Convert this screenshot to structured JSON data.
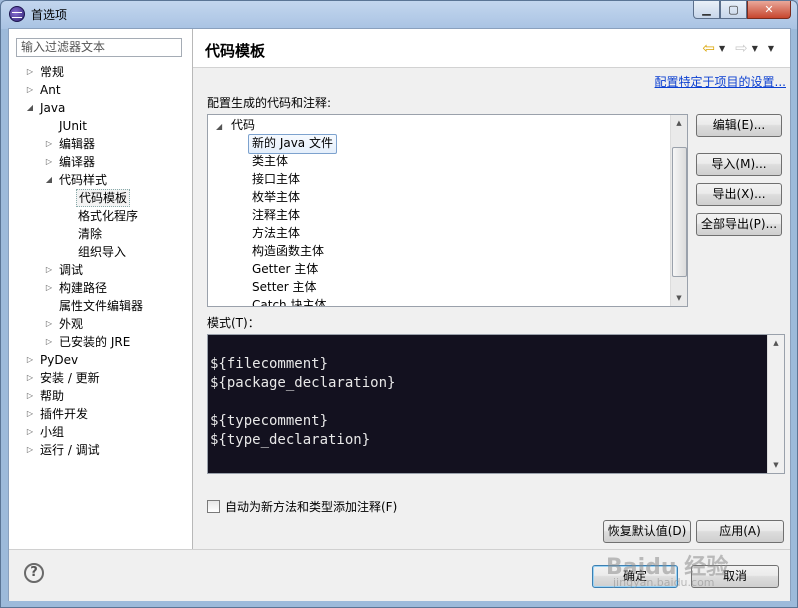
{
  "window": {
    "title": "首选项"
  },
  "sidebar": {
    "filter_placeholder": "输入过滤器文本",
    "tree": [
      {
        "label": "常规",
        "expander": "collapsed"
      },
      {
        "label": "Ant",
        "expander": "collapsed"
      },
      {
        "label": "Java",
        "expander": "expanded"
      },
      {
        "label": "JUnit",
        "expander": "none"
      },
      {
        "label": "编辑器",
        "expander": "collapsed"
      },
      {
        "label": "编译器",
        "expander": "collapsed"
      },
      {
        "label": "代码样式",
        "expander": "expanded"
      },
      {
        "label": "代码模板",
        "expander": "none",
        "selected": true
      },
      {
        "label": "格式化程序",
        "expander": "none"
      },
      {
        "label": "清除",
        "expander": "none"
      },
      {
        "label": "组织导入",
        "expander": "none"
      },
      {
        "label": "调试",
        "expander": "collapsed"
      },
      {
        "label": "构建路径",
        "expander": "collapsed"
      },
      {
        "label": "属性文件编辑器",
        "expander": "none"
      },
      {
        "label": "外观",
        "expander": "collapsed"
      },
      {
        "label": "已安装的 JRE",
        "expander": "collapsed"
      },
      {
        "label": "PyDev",
        "expander": "collapsed"
      },
      {
        "label": "安装 / 更新",
        "expander": "collapsed"
      },
      {
        "label": "帮助",
        "expander": "collapsed"
      },
      {
        "label": "插件开发",
        "expander": "collapsed"
      },
      {
        "label": "小组",
        "expander": "collapsed"
      },
      {
        "label": "运行 / 调试",
        "expander": "collapsed"
      }
    ]
  },
  "main": {
    "title": "代码模板",
    "project_settings_link": "配置特定于项目的设置...",
    "config_label": "配置生成的代码和注释:",
    "code_tree": {
      "root": "代码",
      "items": [
        "新的 Java 文件",
        "类主体",
        "接口主体",
        "枚举主体",
        "注释主体",
        "方法主体",
        "构造函数主体",
        "Getter 主体",
        "Setter 主体",
        "Catch 块主体"
      ],
      "selected": "新的 Java 文件"
    },
    "buttons": {
      "edit": "编辑(E)...",
      "import": "导入(M)...",
      "export": "导出(X)...",
      "export_all": "全部导出(P)..."
    },
    "pattern_label": "模式(T)：",
    "pattern_lines": [
      "",
      "${filecomment}",
      "${package_declaration}",
      "",
      "${typecomment}",
      "${type_declaration}"
    ],
    "auto_comment_checkbox": {
      "label": "自动为新方法和类型添加注释(F)",
      "checked": false
    },
    "restore_defaults": "恢复默认值(D)",
    "apply": "应用(A)"
  },
  "footer": {
    "ok": "确定",
    "cancel": "取消"
  },
  "watermark": {
    "text": "Baidu 经验",
    "subtext": "jingyan.baidu.com"
  },
  "colors": {
    "editor_bg": "#13111f",
    "link": "#0b3fd1",
    "selection_border": "#7da2ce"
  }
}
